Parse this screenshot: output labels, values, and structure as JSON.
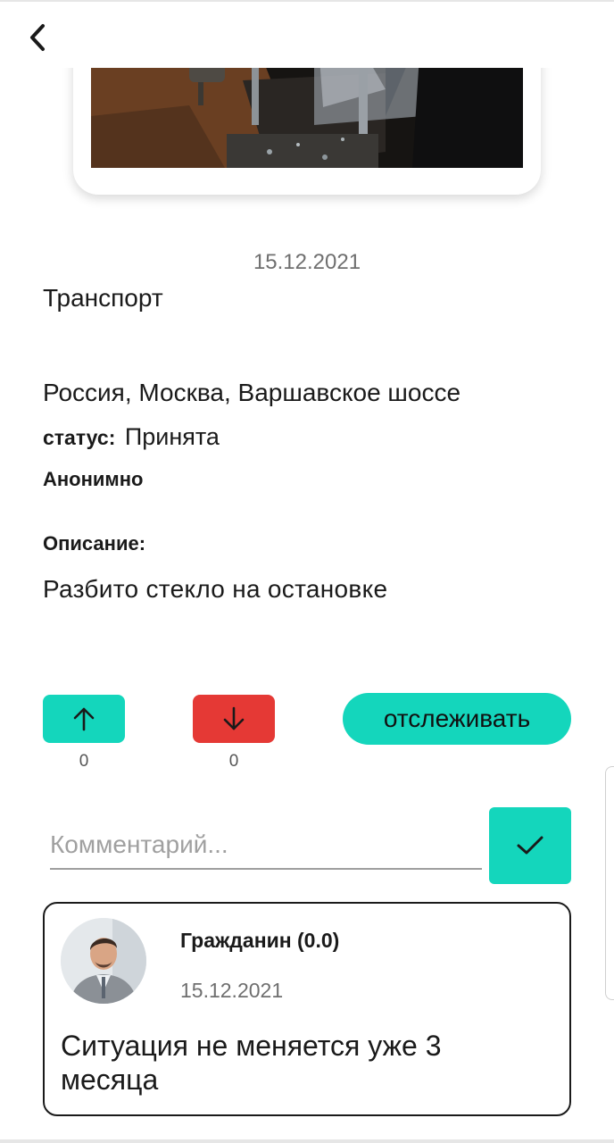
{
  "report": {
    "date": "15.12.2021",
    "category": "Транспорт",
    "address": "Россия, Москва, Варшавское шоссе",
    "status_label": "статус:",
    "status_value": "Принята",
    "anonymous": "Анонимно",
    "description_label": "Описание:",
    "description": "Разбито стекло на остановке"
  },
  "votes": {
    "up_count": "0",
    "down_count": "0"
  },
  "track_button": {
    "label": "отслеживать"
  },
  "comment_form": {
    "placeholder": "Комментарий..."
  },
  "comments": [
    {
      "author": "Гражданин  (0.0)",
      "date": "15.12.2021",
      "text": "Ситуация не меняется уже 3 месяца"
    }
  ],
  "colors": {
    "accent": "#14d6bc",
    "downvote": "#e53935"
  }
}
